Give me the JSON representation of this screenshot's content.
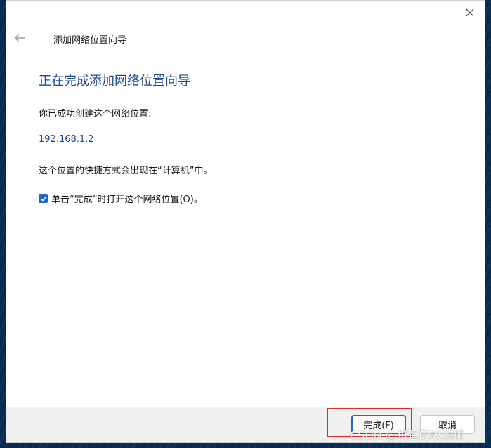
{
  "dialog": {
    "wizard_title": "添加网络位置向导",
    "heading": "正在完成添加网络位置向导",
    "success_text": "你已成功创建这个网络位置:",
    "address": "192.168.1.2",
    "shortcut_text": "这个位置的快捷方式会出现在“计算机”中。",
    "checkbox": {
      "label": "单击“完成”时打开这个网络位置(O)。",
      "checked": true
    }
  },
  "footer": {
    "finish_label": "完成(F)",
    "cancel_label": "取消"
  },
  "watermark": "CSDN @机智的攻城狮",
  "colors": {
    "accent": "#1f66c9",
    "heading": "#1e4a92",
    "highlight": "#e02a2a"
  },
  "icons": {
    "close": "close-icon",
    "back": "back-arrow-icon",
    "check": "checkmark-icon"
  }
}
